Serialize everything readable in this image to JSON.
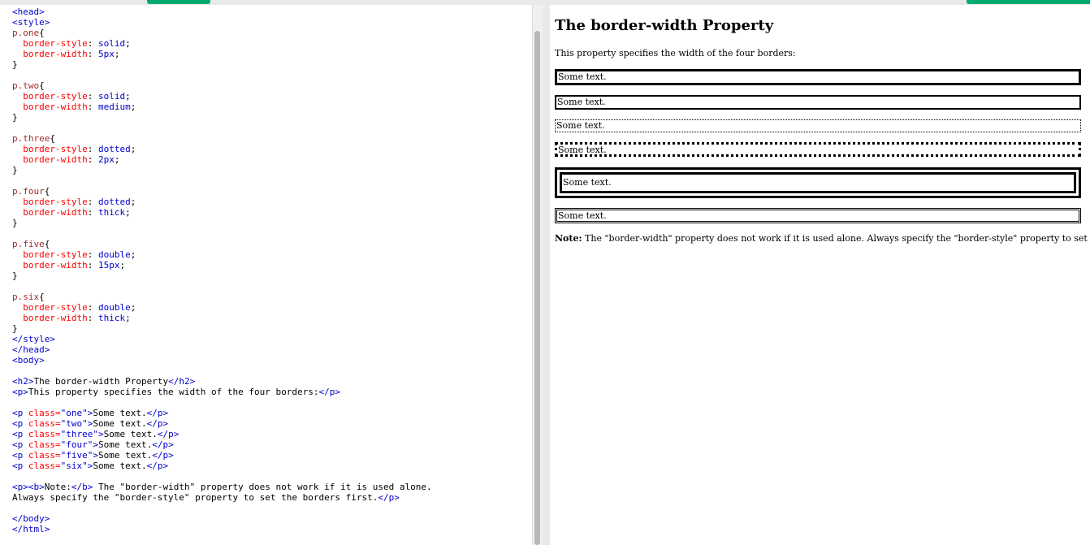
{
  "editor": {
    "lines": [
      [
        [
          "tag",
          "<head>"
        ]
      ],
      [
        [
          "tag",
          "<style>"
        ]
      ],
      [
        [
          "sel",
          "p.one"
        ],
        [
          "",
          "{"
        ]
      ],
      [
        [
          "",
          "  "
        ],
        [
          "prop",
          "border-style"
        ],
        [
          "",
          ": "
        ],
        [
          "val",
          "solid"
        ],
        [
          "",
          ";"
        ]
      ],
      [
        [
          "",
          "  "
        ],
        [
          "prop",
          "border-width"
        ],
        [
          "",
          ": "
        ],
        [
          "val",
          "5px"
        ],
        [
          "",
          ";"
        ]
      ],
      [
        [
          "",
          "}"
        ]
      ],
      [
        [
          "",
          ""
        ]
      ],
      [
        [
          "sel",
          "p.two"
        ],
        [
          "",
          "{"
        ]
      ],
      [
        [
          "",
          "  "
        ],
        [
          "prop",
          "border-style"
        ],
        [
          "",
          ": "
        ],
        [
          "val",
          "solid"
        ],
        [
          "",
          ";"
        ]
      ],
      [
        [
          "",
          "  "
        ],
        [
          "prop",
          "border-width"
        ],
        [
          "",
          ": "
        ],
        [
          "val",
          "medium"
        ],
        [
          "",
          ";"
        ]
      ],
      [
        [
          "",
          "}"
        ]
      ],
      [
        [
          "",
          ""
        ]
      ],
      [
        [
          "sel",
          "p.three"
        ],
        [
          "",
          "{"
        ]
      ],
      [
        [
          "",
          "  "
        ],
        [
          "prop",
          "border-style"
        ],
        [
          "",
          ": "
        ],
        [
          "val",
          "dotted"
        ],
        [
          "",
          ";"
        ]
      ],
      [
        [
          "",
          "  "
        ],
        [
          "prop",
          "border-width"
        ],
        [
          "",
          ": "
        ],
        [
          "val",
          "2px"
        ],
        [
          "",
          ";"
        ]
      ],
      [
        [
          "",
          "}"
        ]
      ],
      [
        [
          "",
          ""
        ]
      ],
      [
        [
          "sel",
          "p.four"
        ],
        [
          "",
          "{"
        ]
      ],
      [
        [
          "",
          "  "
        ],
        [
          "prop",
          "border-style"
        ],
        [
          "",
          ": "
        ],
        [
          "val",
          "dotted"
        ],
        [
          "",
          ";"
        ]
      ],
      [
        [
          "",
          "  "
        ],
        [
          "prop",
          "border-width"
        ],
        [
          "",
          ": "
        ],
        [
          "val",
          "thick"
        ],
        [
          "",
          ";"
        ]
      ],
      [
        [
          "",
          "}"
        ]
      ],
      [
        [
          "",
          ""
        ]
      ],
      [
        [
          "sel",
          "p.five"
        ],
        [
          "",
          "{"
        ]
      ],
      [
        [
          "",
          "  "
        ],
        [
          "prop",
          "border-style"
        ],
        [
          "",
          ": "
        ],
        [
          "val",
          "double"
        ],
        [
          "",
          ";"
        ]
      ],
      [
        [
          "",
          "  "
        ],
        [
          "prop",
          "border-width"
        ],
        [
          "",
          ": "
        ],
        [
          "val",
          "15px"
        ],
        [
          "",
          ";"
        ]
      ],
      [
        [
          "",
          "}"
        ]
      ],
      [
        [
          "",
          ""
        ]
      ],
      [
        [
          "sel",
          "p.six"
        ],
        [
          "",
          "{"
        ]
      ],
      [
        [
          "",
          "  "
        ],
        [
          "prop",
          "border-style"
        ],
        [
          "",
          ": "
        ],
        [
          "val",
          "double"
        ],
        [
          "",
          ";"
        ]
      ],
      [
        [
          "",
          "  "
        ],
        [
          "prop",
          "border-width"
        ],
        [
          "",
          ": "
        ],
        [
          "val",
          "thick"
        ],
        [
          "",
          ";"
        ]
      ],
      [
        [
          "",
          "}"
        ]
      ],
      [
        [
          "tag",
          "</style>"
        ]
      ],
      [
        [
          "tag",
          "</head>"
        ]
      ],
      [
        [
          "tag",
          "<body>"
        ]
      ],
      [
        [
          "",
          ""
        ]
      ],
      [
        [
          "tag",
          "<h2>"
        ],
        [
          "",
          "The border-width Property"
        ],
        [
          "tag",
          "</h2>"
        ]
      ],
      [
        [
          "tag",
          "<p>"
        ],
        [
          "",
          "This property specifies the width of the four borders:"
        ],
        [
          "tag",
          "</p>"
        ]
      ],
      [
        [
          "",
          ""
        ]
      ],
      [
        [
          "tag",
          "<p "
        ],
        [
          "attr",
          "class="
        ],
        [
          "str",
          "\"one\""
        ],
        [
          "tag",
          ">"
        ],
        [
          "",
          "Some text."
        ],
        [
          "tag",
          "</p>"
        ]
      ],
      [
        [
          "tag",
          "<p "
        ],
        [
          "attr",
          "class="
        ],
        [
          "str",
          "\"two\""
        ],
        [
          "tag",
          ">"
        ],
        [
          "",
          "Some text."
        ],
        [
          "tag",
          "</p>"
        ]
      ],
      [
        [
          "tag",
          "<p "
        ],
        [
          "attr",
          "class="
        ],
        [
          "str",
          "\"three\""
        ],
        [
          "tag",
          ">"
        ],
        [
          "",
          "Some text."
        ],
        [
          "tag",
          "</p>"
        ]
      ],
      [
        [
          "tag",
          "<p "
        ],
        [
          "attr",
          "class="
        ],
        [
          "str",
          "\"four\""
        ],
        [
          "tag",
          ">"
        ],
        [
          "",
          "Some text."
        ],
        [
          "tag",
          "</p>"
        ]
      ],
      [
        [
          "tag",
          "<p "
        ],
        [
          "attr",
          "class="
        ],
        [
          "str",
          "\"five\""
        ],
        [
          "tag",
          ">"
        ],
        [
          "",
          "Some text."
        ],
        [
          "tag",
          "</p>"
        ]
      ],
      [
        [
          "tag",
          "<p "
        ],
        [
          "attr",
          "class="
        ],
        [
          "str",
          "\"six\""
        ],
        [
          "tag",
          ">"
        ],
        [
          "",
          "Some text."
        ],
        [
          "tag",
          "</p>"
        ]
      ],
      [
        [
          "",
          ""
        ]
      ],
      [
        [
          "tag",
          "<p><b>"
        ],
        [
          "",
          "Note:"
        ],
        [
          "tag",
          "</b>"
        ],
        [
          "",
          " The \"border-width\" property does not work if it is used alone."
        ]
      ],
      [
        [
          "",
          "Always specify the \"border-style\" property to set the borders first."
        ],
        [
          "tag",
          "</p>"
        ]
      ],
      [
        [
          "",
          ""
        ]
      ],
      [
        [
          "tag",
          "</body>"
        ]
      ],
      [
        [
          "tag",
          "</html>"
        ]
      ]
    ]
  },
  "result": {
    "heading": "The border-width Property",
    "intro": "This property specifies the width of the four borders:",
    "boxes": [
      "Some text.",
      "Some text.",
      "Some text.",
      "Some text.",
      "Some text.",
      "Some text."
    ],
    "note_label": "Note:",
    "note_text": " The \"border-width\" property does not work if it is used alone. Always specify the \"border-style\" property to set the borders first."
  },
  "colors": {
    "accent": "#04aa6d",
    "tag": "#0000cd",
    "property": "#ff0000",
    "selector": "#a52a2a"
  }
}
